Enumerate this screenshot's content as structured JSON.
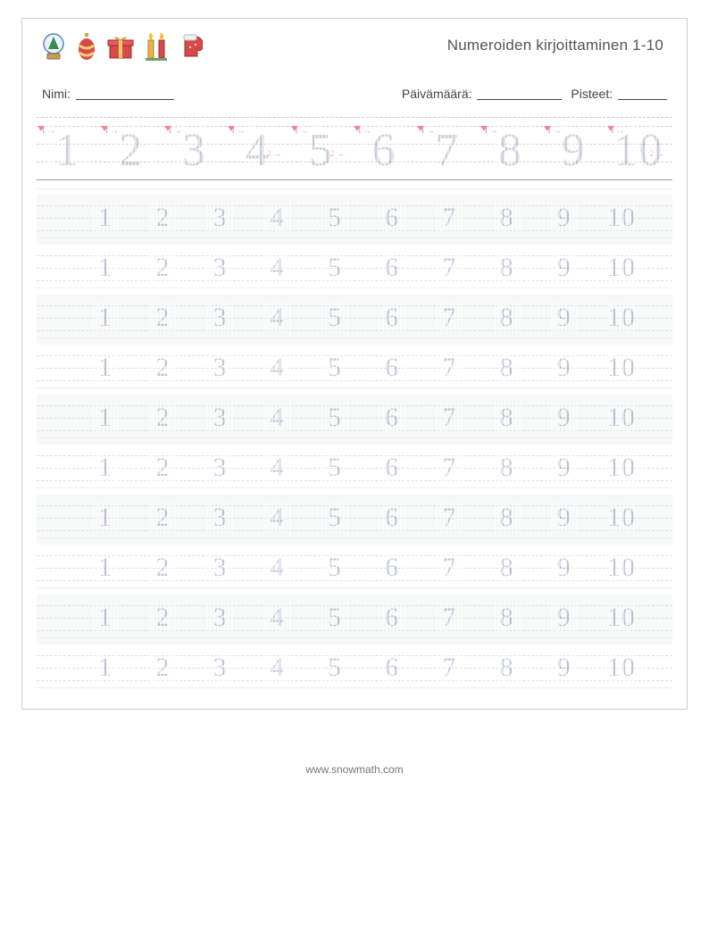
{
  "title": "Numeroiden kirjoittaminen 1-10",
  "labels": {
    "name": "Nimi:",
    "date": "Päivämäärä:",
    "score": "Pisteet:"
  },
  "guide_row": [
    "1",
    "2",
    "3",
    "4",
    "5",
    "6",
    "7",
    "8",
    "9",
    "10"
  ],
  "practice_rows_count": 10,
  "practice_numbers": [
    "1",
    "2",
    "3",
    "4",
    "5",
    "6",
    "7",
    "8",
    "9",
    "10"
  ],
  "stroke_hints": {
    "1": [
      "1"
    ],
    "2": [
      "1"
    ],
    "3": [
      "1"
    ],
    "4": [
      "1",
      "2"
    ],
    "5": [
      "1",
      "2"
    ],
    "6": [
      "1"
    ],
    "7": [
      "1"
    ],
    "8": [
      "1"
    ],
    "9": [
      "1"
    ],
    "10": [
      "1",
      "2"
    ]
  },
  "footer": "www.snowmath.com",
  "icons": [
    "snowglobe-tree",
    "ornament",
    "gift-box",
    "candles-two",
    "mitten"
  ]
}
